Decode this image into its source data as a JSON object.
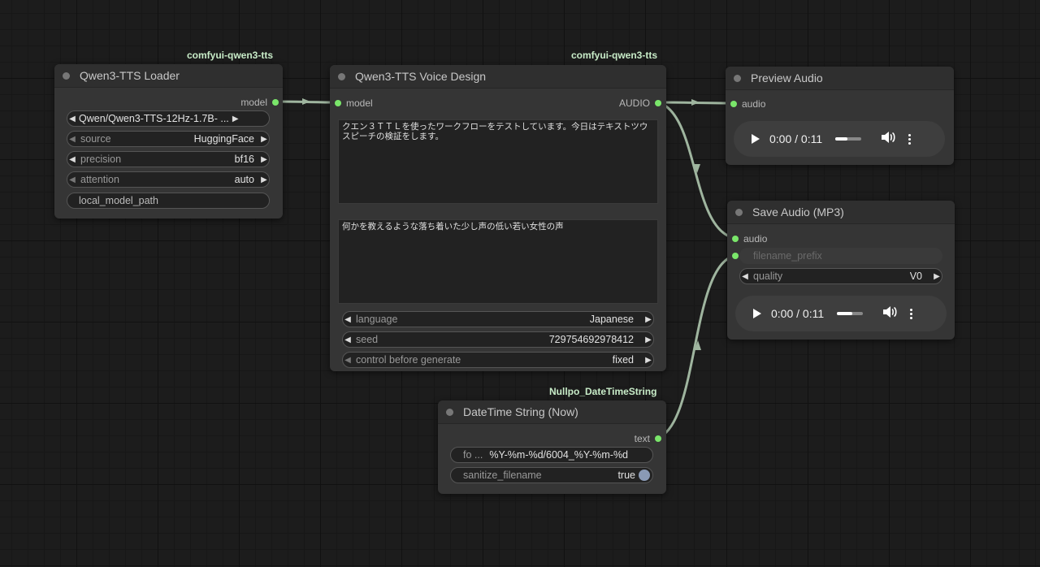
{
  "links_color": "#9fb59f",
  "slot_color": "#7ae66a",
  "loader": {
    "pack": "comfyui-qwen3-tts",
    "title": "Qwen3-TTS Loader",
    "output": "model",
    "model_value": "Qwen/Qwen3-TTS-12Hz-1.7B- ...",
    "source_label": "source",
    "source_value": "HuggingFace",
    "precision_label": "precision",
    "precision_value": "bf16",
    "attention_label": "attention",
    "attention_value": "auto",
    "path_label": "local_model_path"
  },
  "voice": {
    "pack": "comfyui-qwen3-tts",
    "title": "Qwen3-TTS Voice Design",
    "input": "model",
    "output": "AUDIO",
    "text": "クエン３ＴＴＬを使ったワークフローをテストしています。今日はテキストツウスピーチの検証をします。",
    "instruct": "何かを教えるような落ち着いた少し声の低い若い女性の声",
    "language_label": "language",
    "language_value": "Japanese",
    "seed_label": "seed",
    "seed_value": "729754692978412",
    "control_label": "control before generate",
    "control_value": "fixed"
  },
  "preview": {
    "title": "Preview Audio",
    "input": "audio",
    "time": "0:00 / 0:11",
    "progress": 0.45
  },
  "save": {
    "title": "Save Audio (MP3)",
    "input": "audio",
    "prefix_placeholder": "filename_prefix",
    "quality_label": "quality",
    "quality_value": "V0",
    "time": "0:00 / 0:11",
    "progress": 0.6
  },
  "datetime": {
    "pack": "Nullpo_DateTimeString",
    "title": "DateTime String (Now)",
    "output": "text",
    "format_label": "fo ...",
    "format_value": "%Y-%m-%d/6004_%Y-%m-%d",
    "sanitize_label": "sanitize_filename",
    "sanitize_value": "true"
  }
}
